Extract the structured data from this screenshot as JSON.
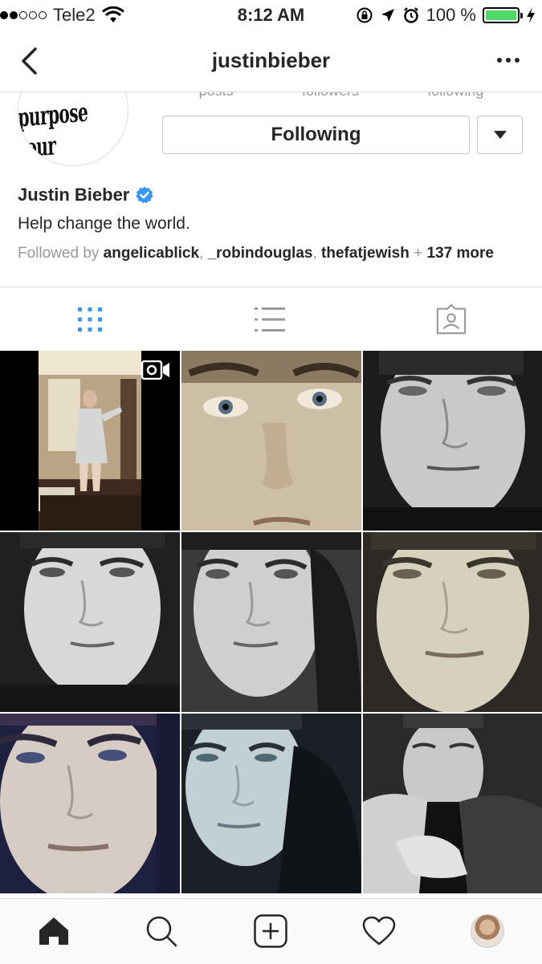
{
  "status_bar": {
    "carrier": "Tele2",
    "time": "8:12 AM",
    "battery_text": "100 %",
    "battery_level": 1.0,
    "signal_strength": 2
  },
  "header": {
    "username": "justinbieber",
    "back_icon": "chevron-left-icon",
    "more_icon": "ellipsis-icon"
  },
  "profile": {
    "avatar_logo_text": "purpose tour",
    "stat_labels": [
      "posts",
      "followers",
      "following"
    ],
    "following_button": "Following",
    "full_name": "Justin Bieber",
    "verified": true,
    "bio": "Help change the world.",
    "followed_by_prefix": "Followed by",
    "followed_by_users": [
      "angelicablick",
      "_robindouglas",
      "thefatjewish"
    ],
    "followed_by_more": "137 more",
    "followed_by_sep": ", ",
    "followed_by_plus": " + "
  },
  "tabs": {
    "grid_icon": "grid-icon",
    "list_icon": "list-icon",
    "tagged_icon": "tagged-photos-icon",
    "active": "grid",
    "active_color": "#3897f0",
    "inactive_color": "#999999"
  },
  "grid": {
    "posts": [
      {
        "type": "video"
      },
      {
        "type": "photo"
      },
      {
        "type": "photo"
      },
      {
        "type": "photo"
      },
      {
        "type": "photo"
      },
      {
        "type": "photo"
      },
      {
        "type": "photo"
      },
      {
        "type": "photo"
      },
      {
        "type": "photo"
      }
    ]
  },
  "tabbar": {
    "items": [
      "home-icon",
      "search-icon",
      "new-post-icon",
      "activity-heart-icon",
      "profile-avatar"
    ]
  },
  "colors": {
    "verified_blue": "#3897f0",
    "battery_green": "#4cd964",
    "border": "#dbdbdb",
    "secondary_text": "#999999"
  }
}
